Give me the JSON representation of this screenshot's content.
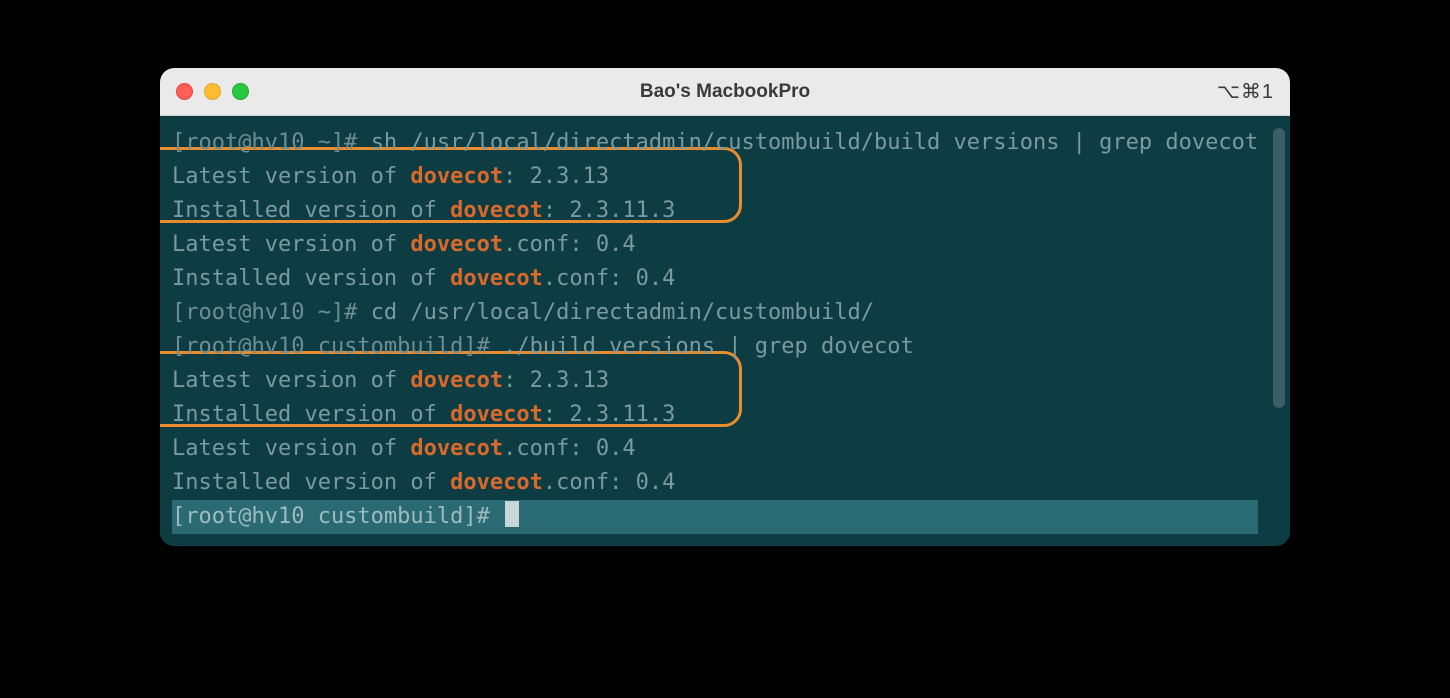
{
  "window": {
    "title": "Bao's MacbookPro",
    "shortcut": "⌥⌘1"
  },
  "colors": {
    "accent_highlight": "#d96a2b",
    "terminal_bg": "#0d3c42",
    "text_dim": "#7a9aa0",
    "annotation_border": "#e88c2e"
  },
  "terminal": {
    "lines": [
      {
        "prompt": "[root@hv10 ~]# ",
        "cmd": "sh /usr/local/directadmin/custombuild/build versions | grep dovecot"
      },
      {
        "pre": "Latest version of ",
        "hl": "dovecot",
        "post": ": 2.3.13"
      },
      {
        "pre": "Installed version of ",
        "hl": "dovecot",
        "post": ": 2.3.11.3"
      },
      {
        "pre": "Latest version of ",
        "hl": "dovecot",
        "post": ".conf: 0.4"
      },
      {
        "pre": "Installed version of ",
        "hl": "dovecot",
        "post": ".conf: 0.4"
      },
      {
        "prompt": "[root@hv10 ~]# ",
        "cmd": "cd /usr/local/directadmin/custombuild/"
      },
      {
        "prompt": "[root@hv10 custombuild]# ",
        "cmd": "./build versions | grep dovecot"
      },
      {
        "pre": "Latest version of ",
        "hl": "dovecot",
        "post": ": 2.3.13"
      },
      {
        "pre": "Installed version of ",
        "hl": "dovecot",
        "post": ": 2.3.11.3"
      },
      {
        "pre": "Latest version of ",
        "hl": "dovecot",
        "post": ".conf: 0.4"
      },
      {
        "pre": "Installed version of ",
        "hl": "dovecot",
        "post": ".conf: 0.4"
      }
    ],
    "active_prompt": "[root@hv10 custombuild]# "
  }
}
